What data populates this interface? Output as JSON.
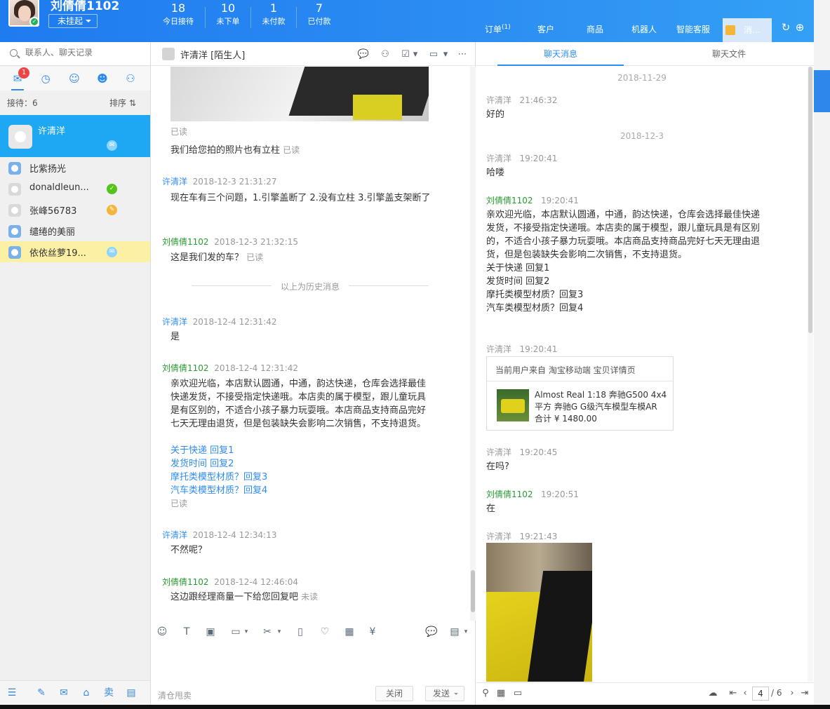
{
  "header": {
    "user_name": "刘倩倩1102",
    "status": "未挂起",
    "stats": [
      {
        "num": "18",
        "label": "今日接待"
      },
      {
        "num": "10",
        "label": "未下单"
      },
      {
        "num": "1",
        "label": "未付款"
      },
      {
        "num": "7",
        "label": "已付款"
      }
    ],
    "nav": {
      "orders": "订单",
      "orders_count": "(1)",
      "customers": "客户",
      "products": "商品",
      "robot": "机器人",
      "smart_service": "智能客服",
      "messages": "消..."
    }
  },
  "sidebar": {
    "search_placeholder": "联系人、聊天记录",
    "unread_badge": "1",
    "receiving": "接待：6",
    "sort": "排序 ⇅",
    "contacts": [
      {
        "name": "许清洋",
        "status_color": "#8fd3ff"
      },
      {
        "name": "比紫扬光",
        "status_color": ""
      },
      {
        "name": "donaldleun...",
        "status_color": "#52c41a"
      },
      {
        "name": "张峰56783",
        "status_color": "#f5b43a"
      },
      {
        "name": "缱绻的美丽",
        "status_color": ""
      },
      {
        "name": "依依丝萝19...",
        "status_color": "#8fd3ff"
      }
    ]
  },
  "chat": {
    "title": "许清洋 [陌生人]",
    "read": "已读",
    "unread": "未读",
    "msg1": "我们给您拍的照片也有立柱",
    "m2_sender": "许清洋",
    "m2_time": "2018-12-3 21:31:27",
    "m2_text": "现在车有三个问题，1.引擎盖断了 2.没有立柱 3.引擎盖支架断了",
    "m3_sender": "刘倩倩1102",
    "m3_time": "2018-12-3 21:32:15",
    "m3_text": "这是我们发的车？",
    "history_divider": "以上为历史消息",
    "m4_sender": "许清洋",
    "m4_time": "2018-12-4 12:31:42",
    "m4_text": "是",
    "m5_sender": "刘倩倩1102",
    "m5_time": "2018-12-4 12:31:42",
    "m5_text": "亲欢迎光临，本店默认圆通，中通，韵达快递，仓库会选择最佳快递发货，不接受指定快递哦。本店卖的属于模型，跟儿童玩具是有区别的，不适合小孩子暴力玩耍哦。本店商品支持商品完好七天无理由退货，但是包装缺失会影响二次销售，不支持退货。",
    "links": [
      "关于快递 回复1",
      "发货时间 回复2",
      "摩托类模型材质？回复3",
      "汽车类模型材质？回复4"
    ],
    "m6_sender": "许清洋",
    "m6_time": "2018-12-4 12:34:13",
    "m6_text": "不然呢？",
    "m7_sender": "刘倩倩1102",
    "m7_time": "2018-12-4 12:46:04",
    "m7_text": "这边跟经理商量一下给您回复吧",
    "quick_reply": "清仓甩卖",
    "close": "关闭",
    "send": "发送"
  },
  "history": {
    "tab_messages": "聊天消息",
    "tab_files": "聊天文件",
    "date1": "2018-11-29",
    "h1_sender": "许清洋",
    "h1_time": "21:46:32",
    "h1_text": "好的",
    "date2": "2018-12-3",
    "h2_sender": "许清洋",
    "h2_time": "19:20:41",
    "h2_text": "哈喽",
    "h3_sender": "刘倩倩1102",
    "h3_time": "19:20:41",
    "h3_text": "亲欢迎光临，本店默认圆通，中通，韵达快递，仓库会选择最佳快递发货，不接受指定快递哦。本店卖的属于模型，跟儿童玩具是有区别的，不适合小孩子暴力玩耍哦。本店商品支持商品完好七天无理由退货，但是包装缺失会影响二次销售，不支持退货。",
    "h4_sender": "许清洋",
    "h4_time": "19:20:41",
    "card_header": "当前用户来自 淘宝移动端 宝贝详情页",
    "card_text": "Almost Real 1:18 奔驰G500 4x4平方 奔驰G G级汽车模型车模AR 合计 ¥ 1480.00",
    "h5_sender": "许清洋",
    "h5_time": "19:20:45",
    "h5_text": "在吗?",
    "h6_sender": "刘倩倩1102",
    "h6_time": "19:20:51",
    "h6_text": "在",
    "h7_sender": "许清洋",
    "h7_time": "19:21:43",
    "page_current": "4",
    "page_total": "/ 6"
  }
}
